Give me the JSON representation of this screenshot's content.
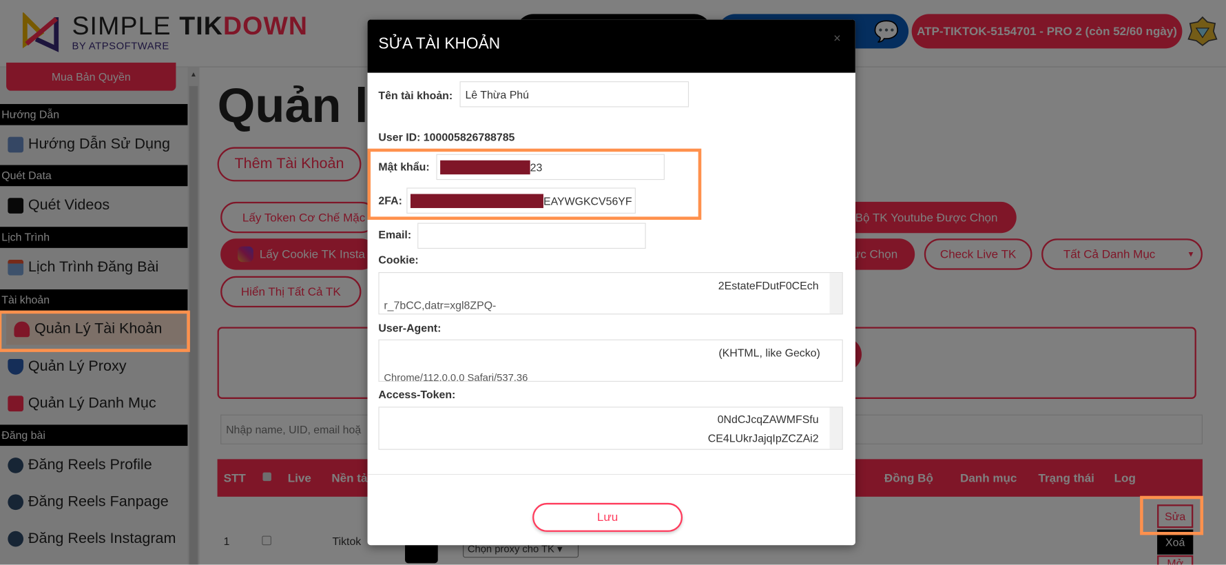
{
  "header": {
    "logo_main_1": "SIMPLE ",
    "logo_main_2": "TIK",
    "logo_main_3": "DOWN",
    "logo_sub": "BY ATPSOFTWARE",
    "license_label": "ATP-TIKTOK-5154701 - PRO 2 (còn 52/60 ngày)",
    "chat_icon": "chat-bubbles-icon",
    "badge_icon": "diamond-badge-icon"
  },
  "sidebar": {
    "buy_label": "Mua Bản Quyền",
    "sections": [
      {
        "title": "Hướng Dẫn",
        "items": [
          {
            "label": "Hướng Dẫn Sử Dụng",
            "icon": "guide-icon"
          }
        ]
      },
      {
        "title": "Quét Data",
        "items": [
          {
            "label": "Quét Videos",
            "icon": "video-icon"
          }
        ]
      },
      {
        "title": "Lịch Trình",
        "items": [
          {
            "label": "Lịch Trình Đăng Bài",
            "icon": "calendar-icon"
          }
        ]
      },
      {
        "title": "Tài khoản",
        "items": [
          {
            "label": "Quản Lý Tài Khoản",
            "icon": "user-icon",
            "active": true
          },
          {
            "label": "Quản Lý Proxy",
            "icon": "shield-icon"
          },
          {
            "label": "Quản Lý Danh Mục",
            "icon": "list-icon"
          }
        ]
      },
      {
        "title": "Đăng bài",
        "items": [
          {
            "label": "Đăng Reels Profile",
            "icon": "cloud-upload-icon"
          },
          {
            "label": "Đăng Reels Fanpage",
            "icon": "cloud-upload-icon"
          },
          {
            "label": "Đăng Reels Instagram",
            "icon": "cloud-upload-icon"
          }
        ]
      }
    ]
  },
  "main": {
    "title": "Quản lý",
    "add_account": "Thêm Tài Khoản",
    "get_token": "Lấy Token Cơ Chế Mặc",
    "sync_youtube": "Bộ TK Youtube Được Chọn",
    "get_cookie_ig": "Lấy Cookie TK Insta",
    "selected_action": "ực Chọn",
    "check_live": "Check Live TK",
    "category_select": "Tất Cả Danh Mục",
    "show_all": "Hiển Thị Tất Cả TK",
    "search_placeholder": "Nhập name, UID, email hoặ",
    "table": {
      "headers": [
        "STT",
        "Live",
        "Nền tả",
        "Đồng Bộ",
        "Danh mục",
        "Trạng thái",
        "Log"
      ],
      "rows": [
        {
          "stt": "1",
          "platform": "Tiktok",
          "proxy": "Chọn proxy cho TK",
          "edit": "Sửa",
          "delete": "Xoá",
          "open": "Mở"
        }
      ]
    }
  },
  "modal": {
    "title": "SỬA TÀI KHOẢN",
    "name_label": "Tên tài khoản:",
    "name_value": "Lê Thừa Phú",
    "user_id_label": "User ID:",
    "user_id": "100005826788785",
    "password_label": "Mật khẩu:",
    "password_visible": "23",
    "twofa_label": "2FA:",
    "twofa_visible": "EAYWGKCV56YF",
    "email_label": "Email:",
    "email_value": "",
    "cookie_label": "Cookie:",
    "cookie_line1": "2EstateFDutF0CEch",
    "cookie_line2": "r_7bCC,datr=xgl8ZPQ-",
    "ua_label": "User-Agent:",
    "ua_line1": "(KHTML, like Gecko)",
    "ua_line2": "Chrome/112.0.0.0 Safari/537.36",
    "token_label": "Access-Token:",
    "token_line1": "0NdCJcqZAWMFSfu",
    "token_line2": "CE4LUkrJajqIpZCZAi2",
    "save": "Lưu"
  },
  "colors": {
    "brand_red": "#fe2c50",
    "highlight": "#ff914d",
    "header_blue": "#0b5cbd"
  }
}
